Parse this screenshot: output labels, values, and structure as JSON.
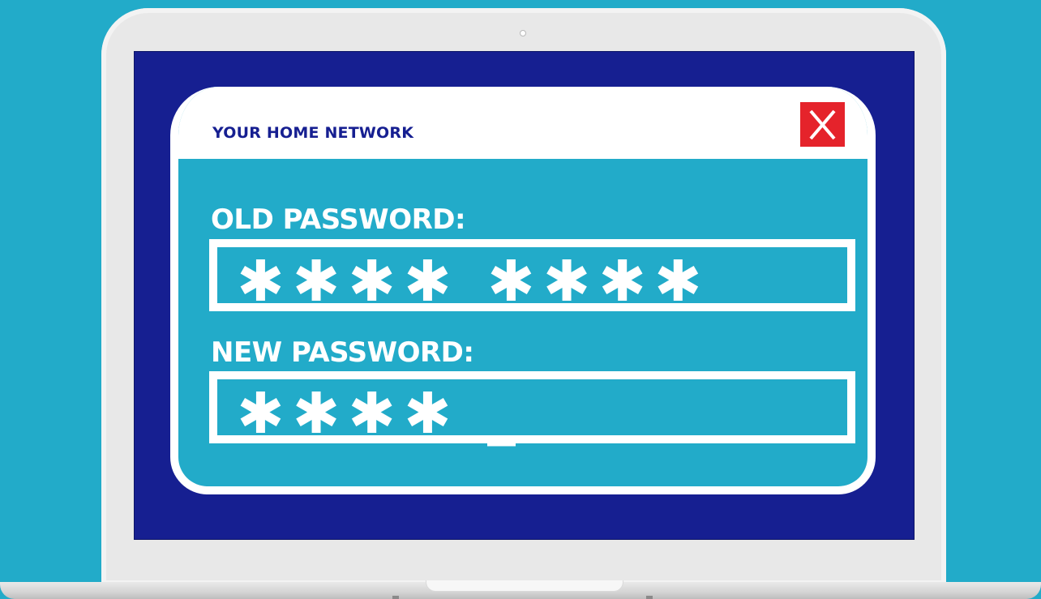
{
  "window": {
    "title": "YOUR HOME NETWORK",
    "close_label": "X"
  },
  "fields": {
    "old_password": {
      "label": "OLD PASSWORD:",
      "value": "✱✱✱✱ ✱✱✱✱"
    },
    "new_password": {
      "label": "NEW PASSWORD:",
      "value": "✱✱✱✱ _"
    }
  },
  "colors": {
    "background": "#22abc9",
    "screen": "#161f91",
    "dialog_fill": "#22abc9",
    "close_button": "#e5232b",
    "text_on_dialog": "#ffffff"
  }
}
